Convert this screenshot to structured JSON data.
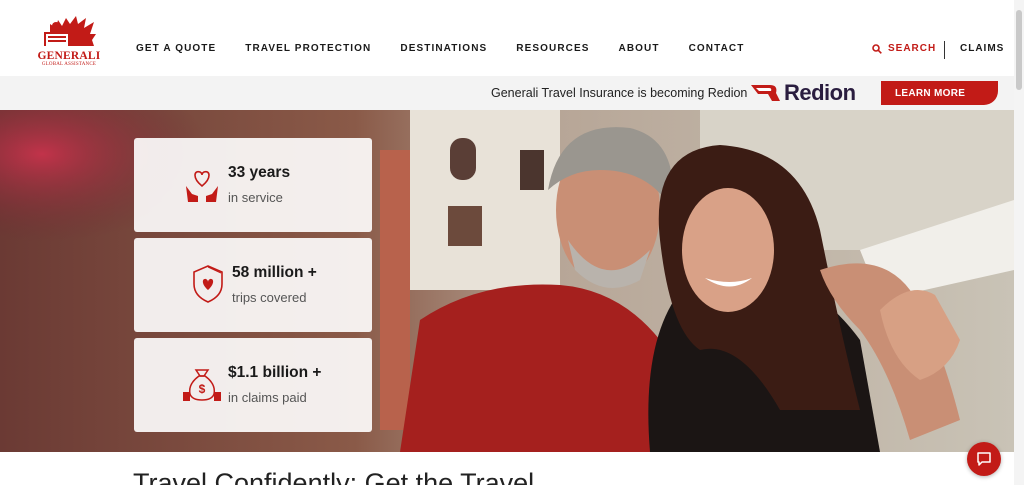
{
  "logo": {
    "brand": "GENERALI",
    "sub": "GLOBAL ASSISTANCE",
    "icon": "winged-lion-icon"
  },
  "nav": {
    "items": [
      "GET A QUOTE",
      "TRAVEL PROTECTION",
      "DESTINATIONS",
      "RESOURCES",
      "ABOUT",
      "CONTACT"
    ],
    "search_label": "SEARCH",
    "claims_label": "CLAIMS"
  },
  "banner": {
    "text": "Generali Travel Insurance is becoming Redion",
    "redion_logo": "Redion",
    "button_label": "LEARN MORE"
  },
  "stats": [
    {
      "value": "33 years",
      "label": "in service",
      "icon": "heart-hands-icon"
    },
    {
      "value": "58 million +",
      "label": "trips covered",
      "icon": "shield-heart-icon"
    },
    {
      "value": "$1.1 billion +",
      "label": "in claims paid",
      "icon": "money-bag-icon"
    }
  ],
  "heading_partial": "Travel Confidently: Get the Travel",
  "colors": {
    "brand_red": "#c21b17",
    "redion_navy": "#2a1d3f"
  }
}
